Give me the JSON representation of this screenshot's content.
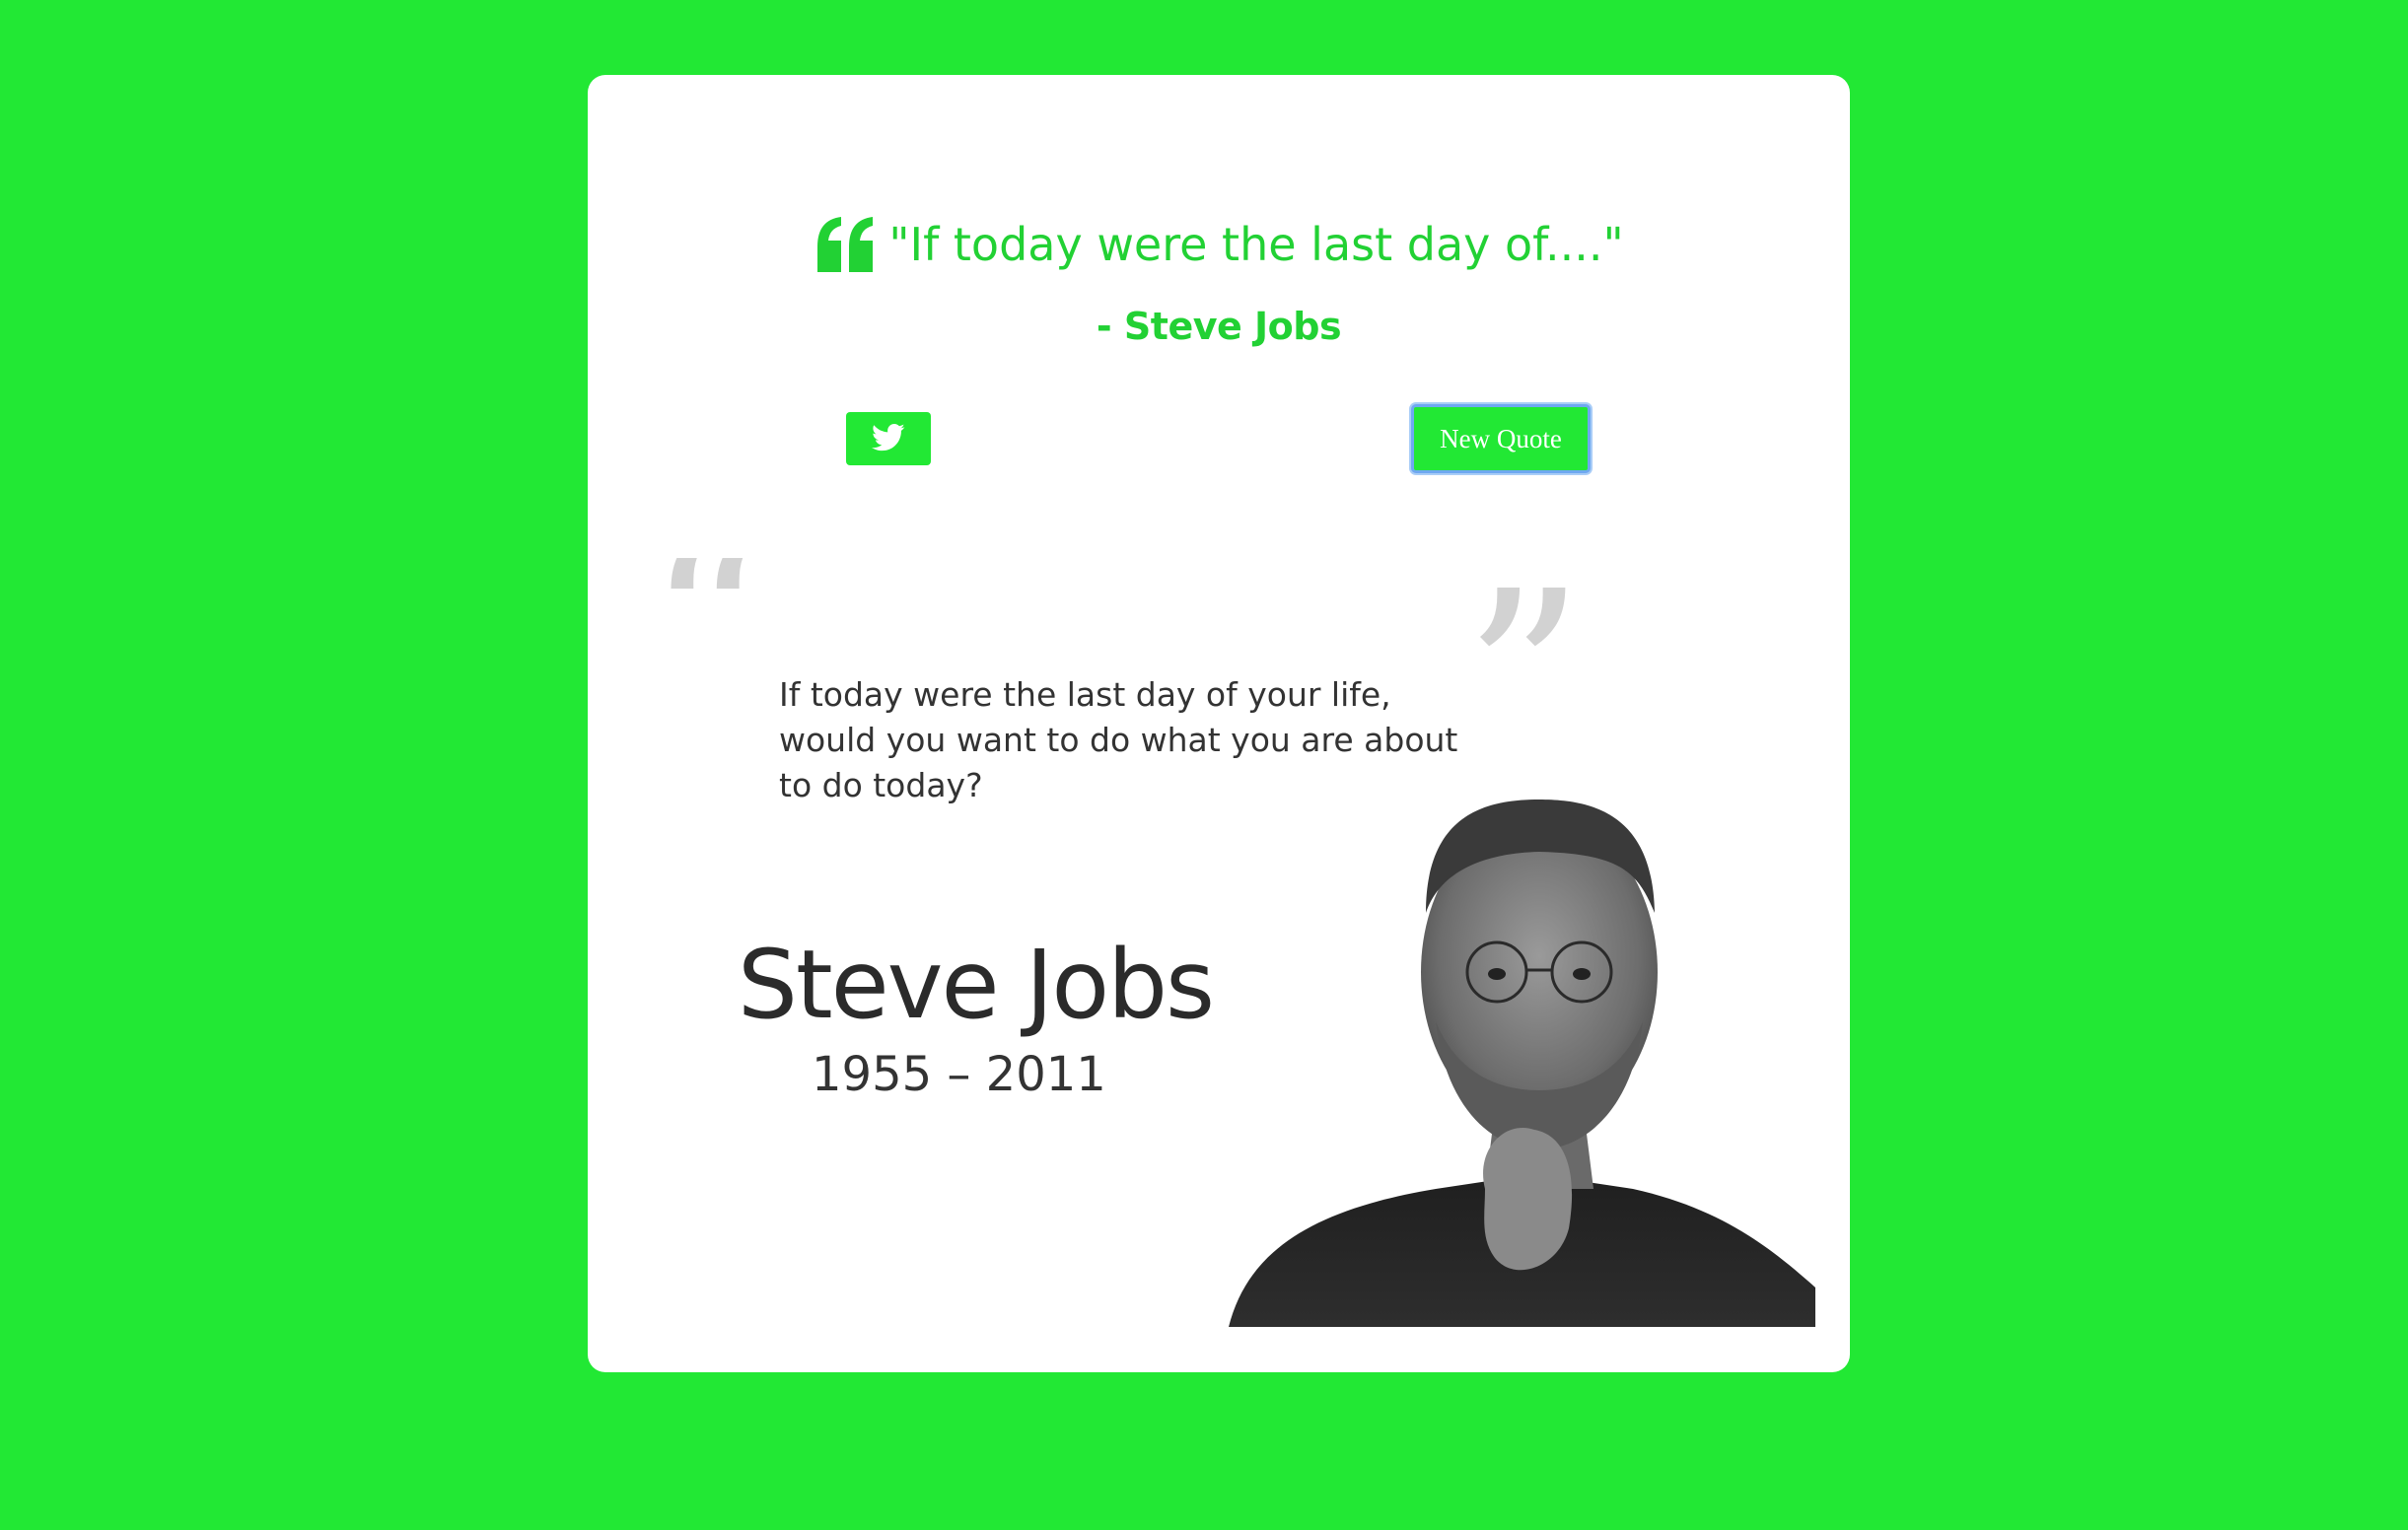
{
  "colors": {
    "accent": "#22e834",
    "quote_text": "#22d134",
    "card_background": "#ffffff",
    "button_focus_ring": "#6fa8f0"
  },
  "quote": {
    "icon": "quote-left-icon",
    "text": "\"If today were the last day of....\"",
    "author": "- Steve Jobs"
  },
  "actions": {
    "tweet_icon": "twitter-icon",
    "new_quote_label": "New Quote"
  },
  "poster": {
    "quote_lines": [
      "If today were the last day of your life,",
      "would you want to do what you are about",
      "to do today?"
    ],
    "name": "Steve Jobs",
    "years": "1955 – 2011",
    "open_quote_mark": "“",
    "close_quote_mark": "”"
  }
}
